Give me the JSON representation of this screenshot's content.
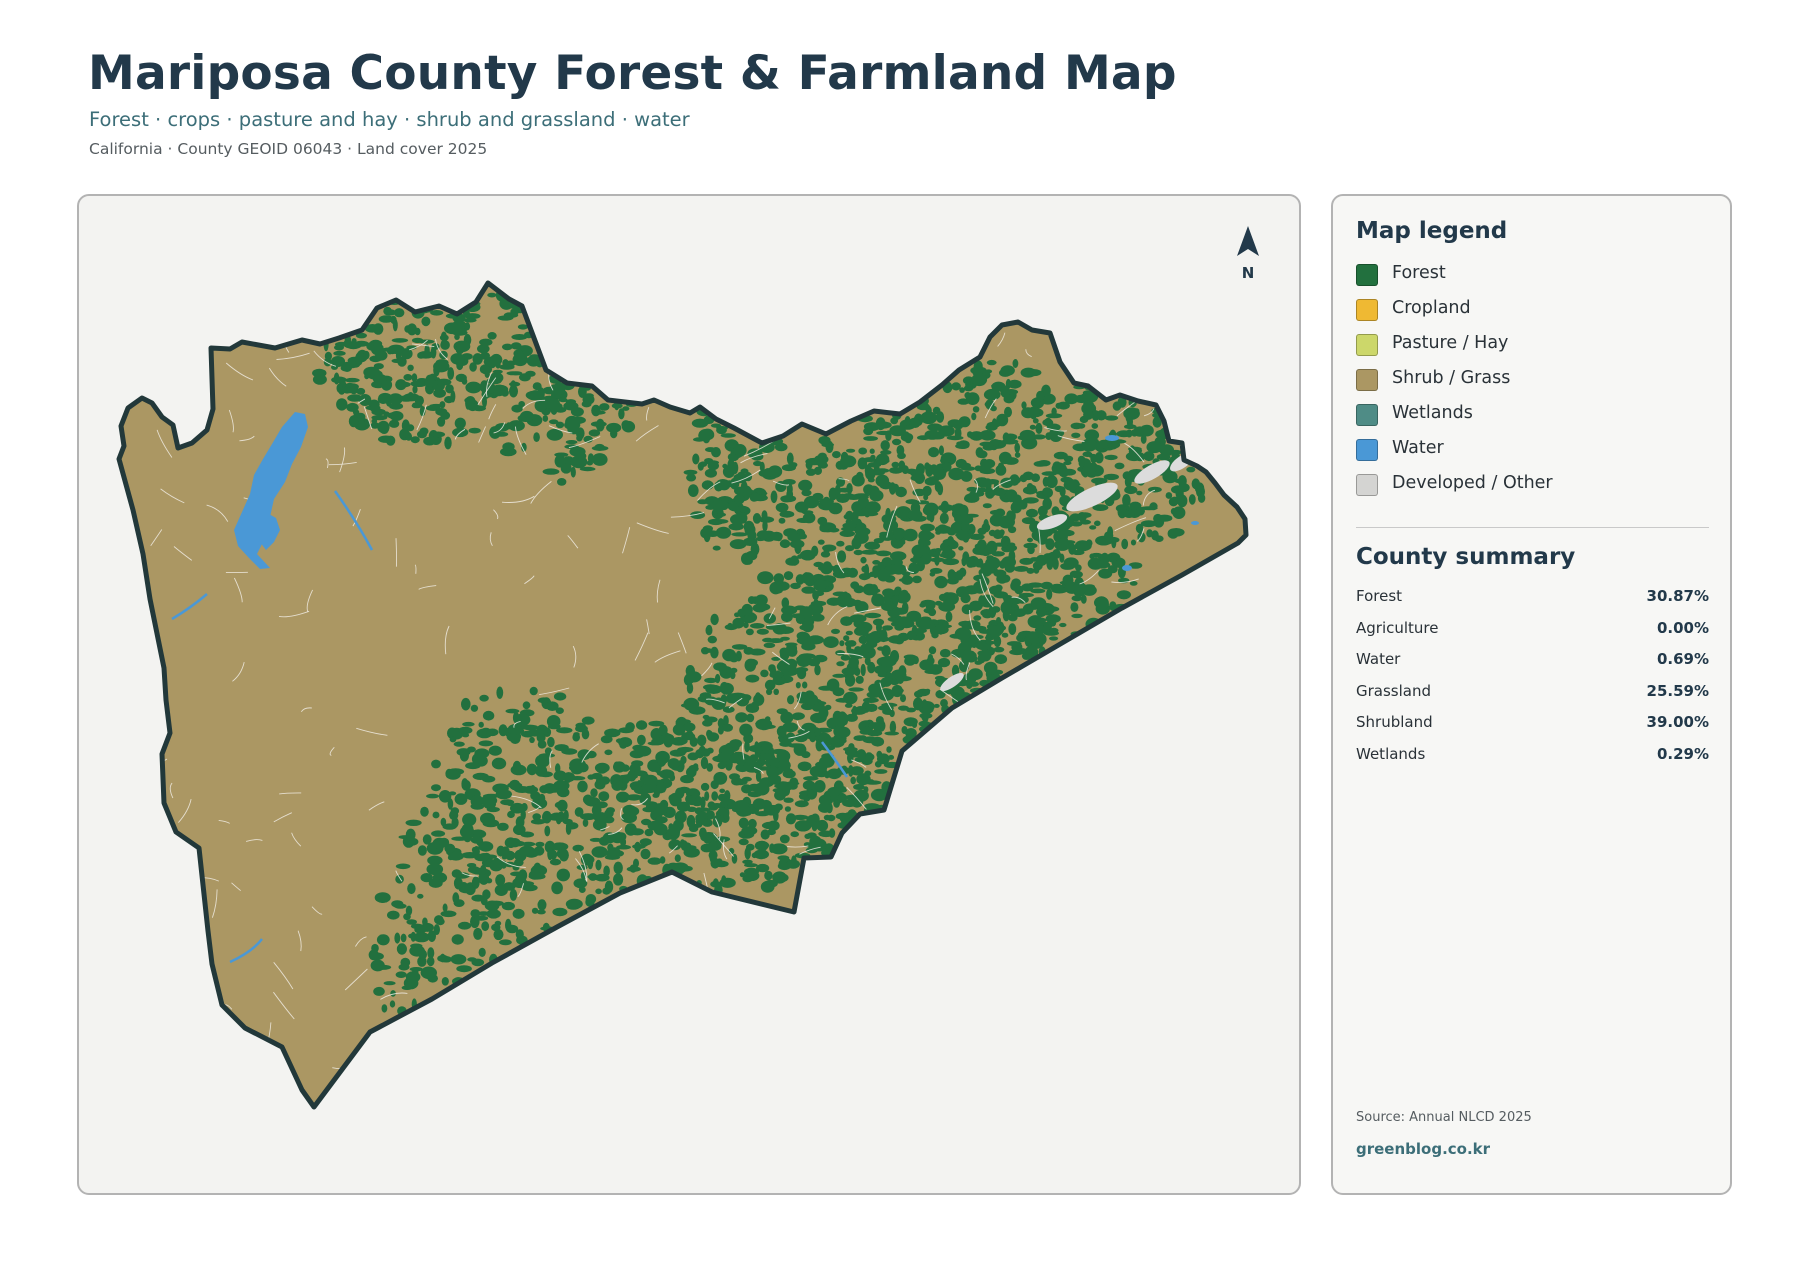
{
  "header": {
    "title": "Mariposa County Forest & Farmland Map",
    "subtitle": "Forest · crops · pasture and hay · shrub and grassland · water",
    "meta": "California · County GEOID 06043 · Land cover 2025"
  },
  "map": {
    "north_label": "N",
    "colors": {
      "forest": "#22703e",
      "shrub_grass": "#ab9763",
      "water": "#4a98d6",
      "developed": "#dcdcdc",
      "boundary": "#22383a",
      "panel_background": "#f3f3f1"
    }
  },
  "legend": {
    "title": "Map legend",
    "items": [
      {
        "label": "Forest",
        "color": "#22703e"
      },
      {
        "label": "Cropland",
        "color": "#efb933"
      },
      {
        "label": "Pasture / Hay",
        "color": "#ccd76a"
      },
      {
        "label": "Shrub / Grass",
        "color": "#ab9763"
      },
      {
        "label": "Wetlands",
        "color": "#4f8c86"
      },
      {
        "label": "Water",
        "color": "#4a98d6"
      },
      {
        "label": "Developed / Other",
        "color": "#d4d4d2"
      }
    ]
  },
  "summary": {
    "title": "County summary",
    "rows": [
      {
        "label": "Forest",
        "value": "30.87%"
      },
      {
        "label": "Agriculture",
        "value": "0.00%"
      },
      {
        "label": "Water",
        "value": "0.69%"
      },
      {
        "label": "Grassland",
        "value": "25.59%"
      },
      {
        "label": "Shrubland",
        "value": "39.00%"
      },
      {
        "label": "Wetlands",
        "value": "0.29%"
      }
    ],
    "source": "Source: Annual NLCD 2025",
    "site": "greenblog.co.kr"
  }
}
